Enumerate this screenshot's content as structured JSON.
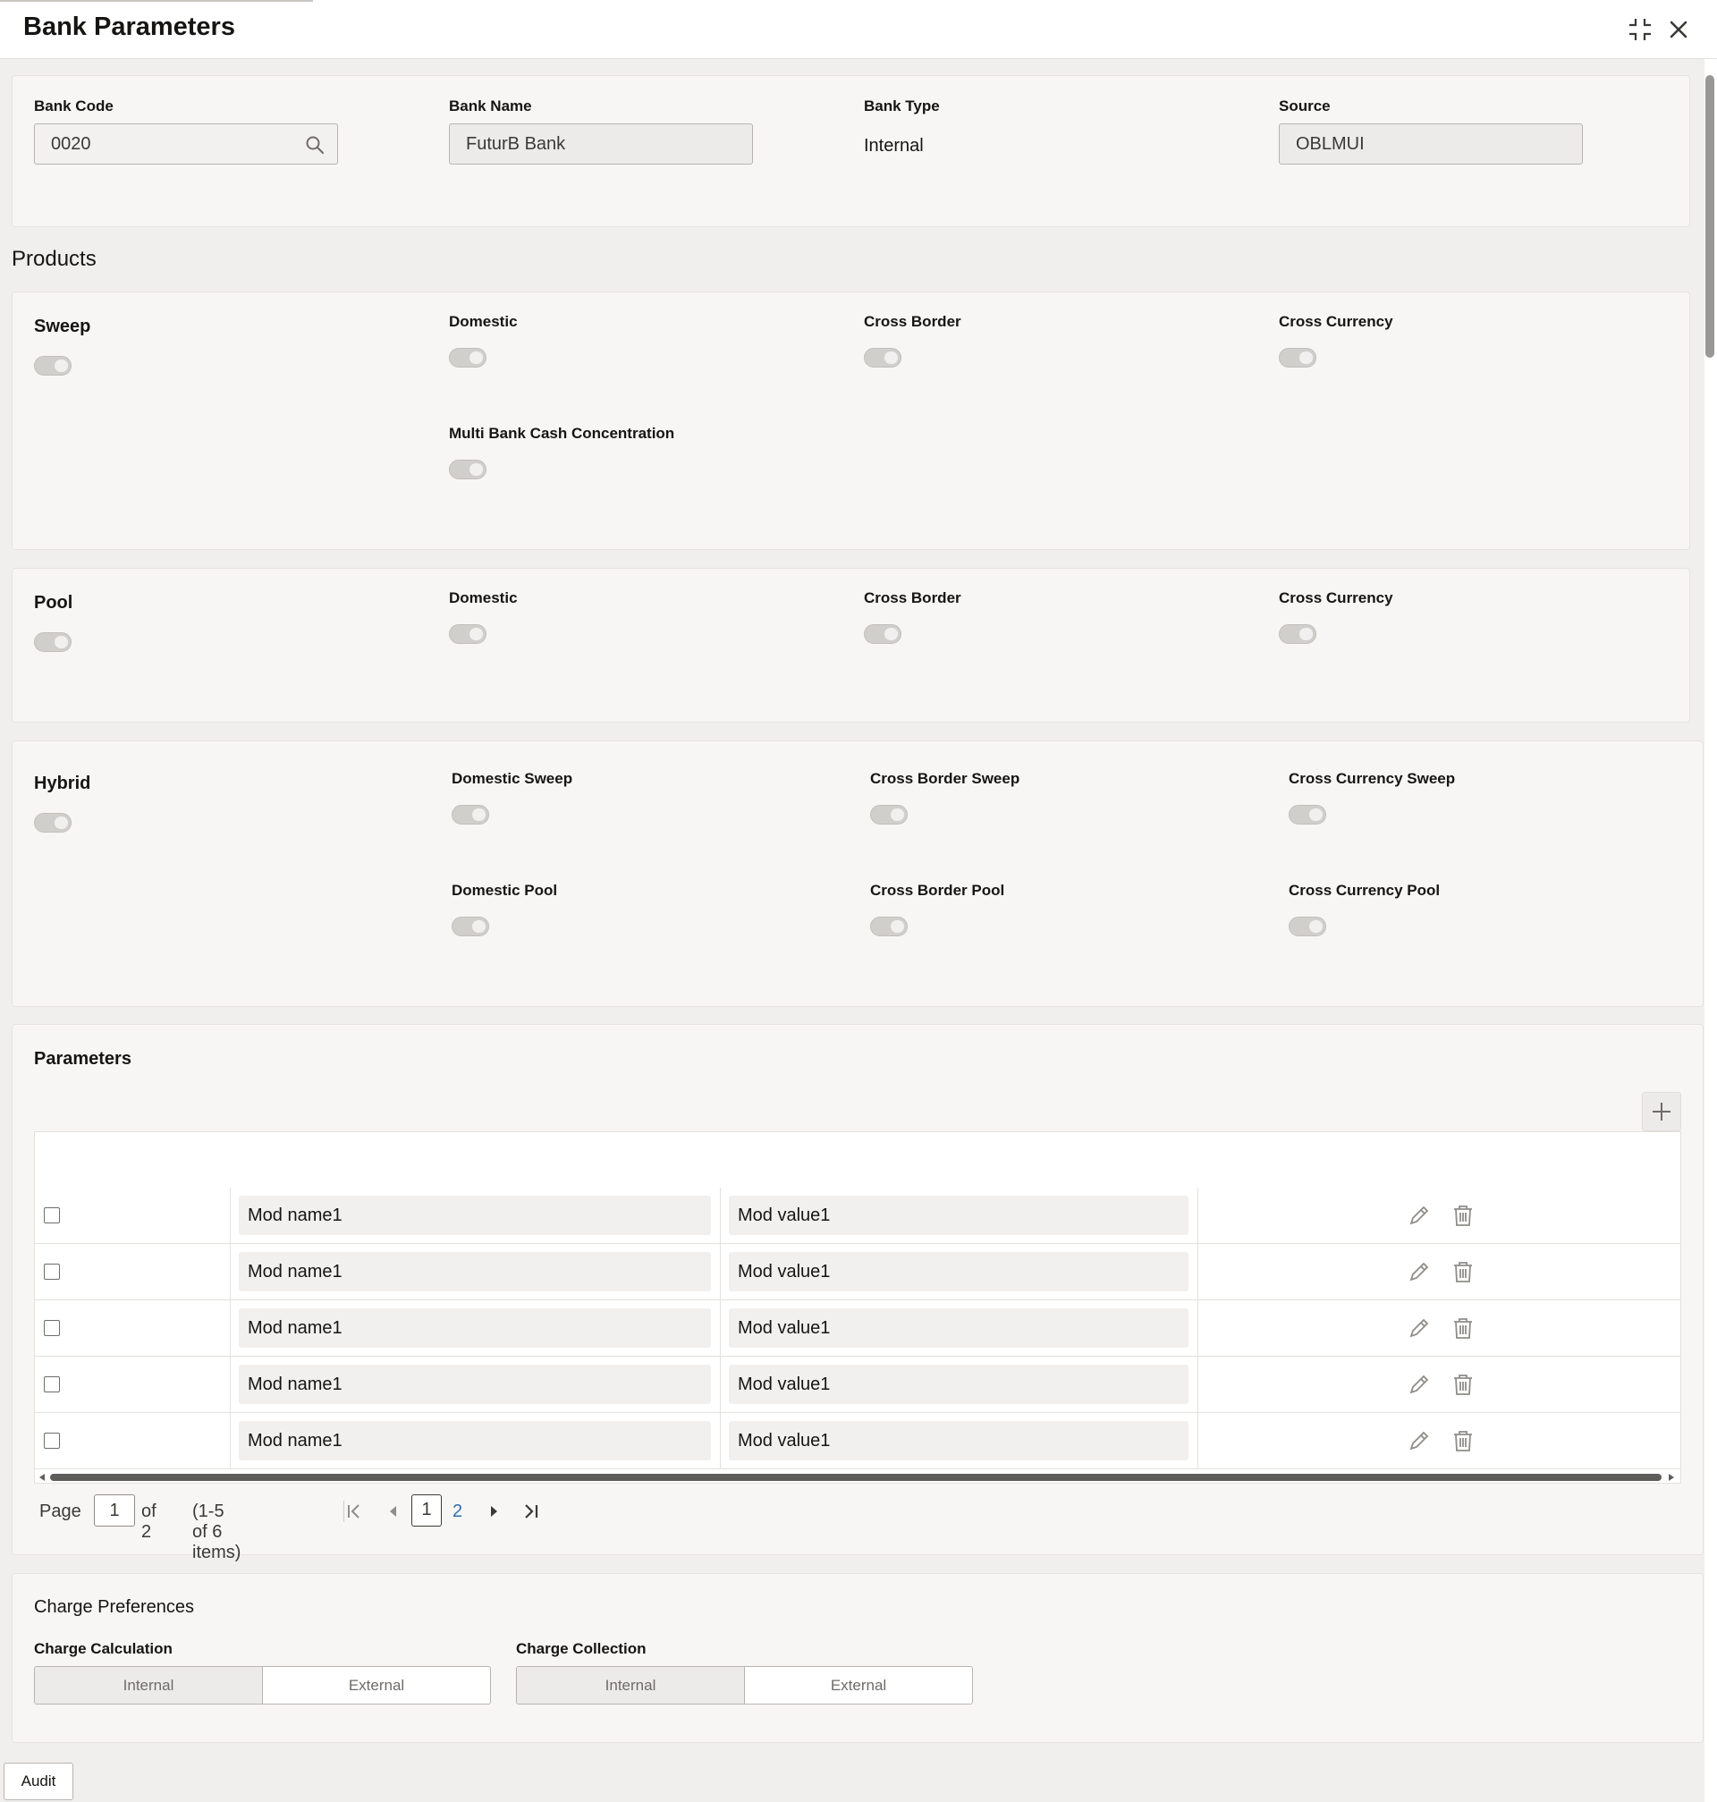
{
  "window": {
    "title": "Bank Parameters"
  },
  "header_fields": {
    "bank_code": {
      "label": "Bank Code",
      "value": "0020"
    },
    "bank_name": {
      "label": "Bank Name",
      "value": "FuturB Bank"
    },
    "bank_type": {
      "label": "Bank Type",
      "value": "Internal"
    },
    "source": {
      "label": "Source",
      "value": "OBLMUI"
    }
  },
  "products": {
    "title": "Products",
    "sweep": {
      "title": "Sweep",
      "options": [
        "Domestic",
        "Cross Border",
        "Cross Currency",
        "Multi Bank Cash Concentration"
      ]
    },
    "pool": {
      "title": "Pool",
      "options": [
        "Domestic",
        "Cross Border",
        "Cross Currency"
      ]
    },
    "hybrid": {
      "title": "Hybrid",
      "options": [
        "Domestic Sweep",
        "Cross Border Sweep",
        "Cross Currency Sweep",
        "Domestic Pool",
        "Cross Border Pool",
        "Cross Currency Pool"
      ]
    }
  },
  "parameters": {
    "title": "Parameters",
    "rows": [
      {
        "name": "Mod name1",
        "value": "Mod value1"
      },
      {
        "name": "Mod name1",
        "value": "Mod value1"
      },
      {
        "name": "Mod name1",
        "value": "Mod value1"
      },
      {
        "name": "Mod name1",
        "value": "Mod value1"
      },
      {
        "name": "Mod name1",
        "value": "Mod value1"
      }
    ],
    "pagination": {
      "page_label": "Page",
      "page_value": "1",
      "of_label": "of 2",
      "items_label": "(1-5 of 6 items)",
      "current_page": "1",
      "next_page": "2"
    }
  },
  "charge_preferences": {
    "title": "Charge Preferences",
    "calculation": {
      "label": "Charge Calculation",
      "options": [
        "Internal",
        "External"
      ],
      "selected": "Internal"
    },
    "collection": {
      "label": "Charge Collection",
      "options": [
        "Internal",
        "External"
      ],
      "selected": "Internal"
    }
  },
  "footer": {
    "audit_label": "Audit"
  },
  "icons": [
    "search-icon",
    "compress-icon",
    "close-icon",
    "plus-icon",
    "edit-icon",
    "trash-icon",
    "first-page-icon",
    "prev-page-icon",
    "next-page-icon",
    "last-page-icon"
  ]
}
